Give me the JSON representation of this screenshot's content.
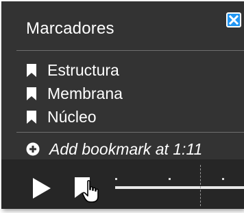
{
  "panel": {
    "title": "Marcadores",
    "close_icon": "close-x-icon",
    "bookmarks": [
      {
        "label": "Estructura",
        "icon": "bookmark-icon"
      },
      {
        "label": "Membrana",
        "icon": "bookmark-icon"
      },
      {
        "label": "Núcleo",
        "icon": "bookmark-icon"
      }
    ],
    "add_bookmark_label": "Add bookmark at 1:11",
    "add_icon": "plus-circle-icon"
  },
  "controls": {
    "play_icon": "play-icon",
    "bookmark_button_icon": "bookmark-icon",
    "cursor_icon": "hand-pointer-icon"
  },
  "colors": {
    "panel_bg": "#333333",
    "controls_bg": "#262626",
    "close_accent": "#2196f3",
    "text": "#ffffff"
  }
}
